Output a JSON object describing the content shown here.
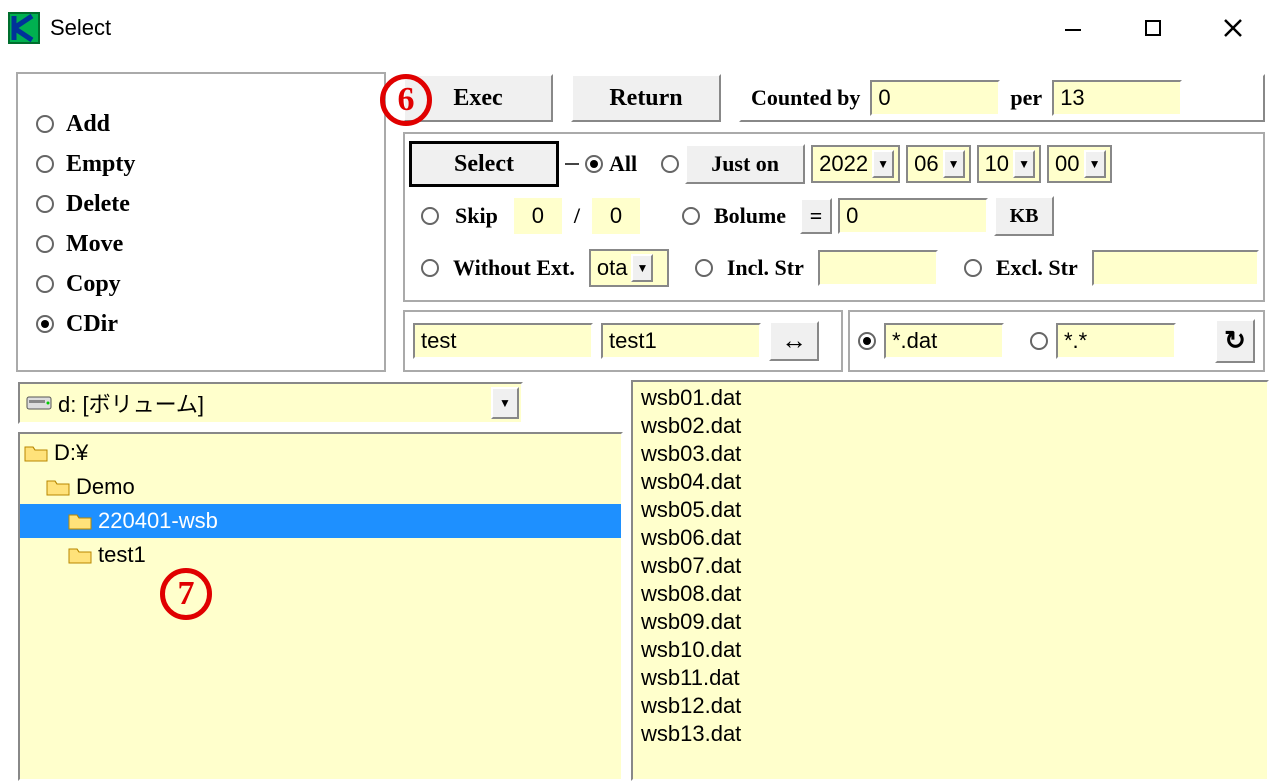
{
  "window": {
    "title": "Select"
  },
  "ops": {
    "add": "Add",
    "empty": "Empty",
    "delete": "Delete",
    "move": "Move",
    "copy": "Copy",
    "cdir": "CDir",
    "selected": "cdir"
  },
  "topbar": {
    "exec": "Exec",
    "return": "Return",
    "counted_by_label": "Counted by",
    "counted_by_value": "0",
    "per_label": "per",
    "per_value": "13"
  },
  "filter": {
    "select_btn": "Select",
    "all_label": "All",
    "juston_label": "Just on",
    "year": "2022",
    "month": "06",
    "day": "10",
    "hour": "00",
    "skip_label": "Skip",
    "skip_a": "0",
    "skip_slash": "/",
    "skip_b": "0",
    "bolume_label": "Bolume",
    "bolume_eq": "=",
    "bolume_val": "0",
    "bolume_unit": "KB",
    "without_ext_label": "Without Ext.",
    "without_ext_val": "ota",
    "incl_label": "Incl. Str",
    "incl_val": "",
    "excl_label": "Excl. Str",
    "excl_val": ""
  },
  "names": {
    "a": "test",
    "b": "test1",
    "swap": "↔"
  },
  "ext": {
    "dat": "*.dat",
    "all": "*.*",
    "refresh": "↻"
  },
  "drive": {
    "label": "d: [ボリューム]"
  },
  "tree": [
    {
      "label": "D:¥",
      "indent": 0,
      "sel": false
    },
    {
      "label": "Demo",
      "indent": 1,
      "sel": false
    },
    {
      "label": "220401-wsb",
      "indent": 2,
      "sel": true
    },
    {
      "label": "test1",
      "indent": 2,
      "sel": false
    }
  ],
  "files": [
    "wsb01.dat",
    "wsb02.dat",
    "wsb03.dat",
    "wsb04.dat",
    "wsb05.dat",
    "wsb06.dat",
    "wsb07.dat",
    "wsb08.dat",
    "wsb09.dat",
    "wsb10.dat",
    "wsb11.dat",
    "wsb12.dat",
    "wsb13.dat"
  ],
  "annotations": {
    "six": "6",
    "seven": "7"
  }
}
